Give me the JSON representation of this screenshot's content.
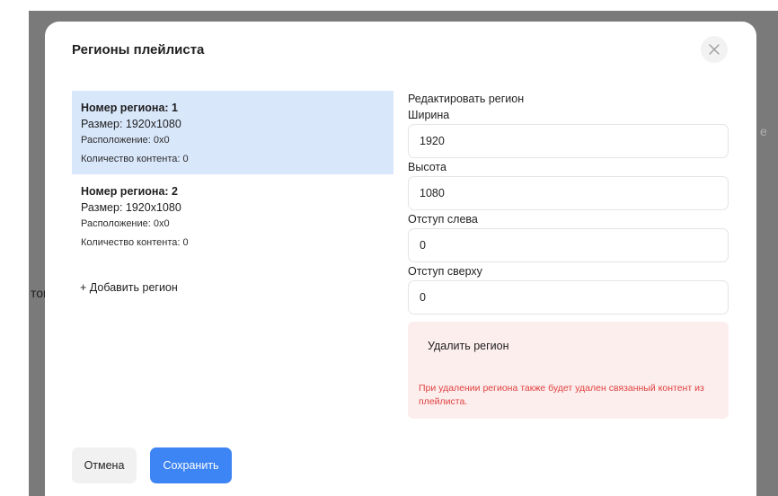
{
  "background": {
    "left_text": "тов",
    "right_text": "e"
  },
  "modal": {
    "title": "Регионы плейлиста",
    "close_icon": "close-icon"
  },
  "regions": [
    {
      "name": "Номер региона: 1",
      "size": "Размер: 1920x1080",
      "position": "Расположение: 0x0",
      "content_count": "Количество контента: 0",
      "selected": true
    },
    {
      "name": "Номер региона: 2",
      "size": "Размер: 1920x1080",
      "position": "Расположение: 0x0",
      "content_count": "Количество контента: 0",
      "selected": false
    }
  ],
  "add_region_label": "+ Добавить регион",
  "editor": {
    "title": "Редактировать регион",
    "fields": [
      {
        "label": "Ширина",
        "value": "1920"
      },
      {
        "label": "Высота",
        "value": "1080"
      },
      {
        "label": "Отступ слева",
        "value": "0"
      },
      {
        "label": "Отступ сверху",
        "value": "0"
      }
    ],
    "delete_label": "Удалить регион",
    "delete_warning": "При удалении региона также будет удален связанный контент из плейлиста."
  },
  "footer": {
    "cancel_label": "Отмена",
    "save_label": "Сохранить"
  },
  "colors": {
    "accent": "#3d84f4",
    "selected_bg": "#d9e7fb",
    "danger_bg": "#fdeeee",
    "danger_text": "#e0413e"
  }
}
